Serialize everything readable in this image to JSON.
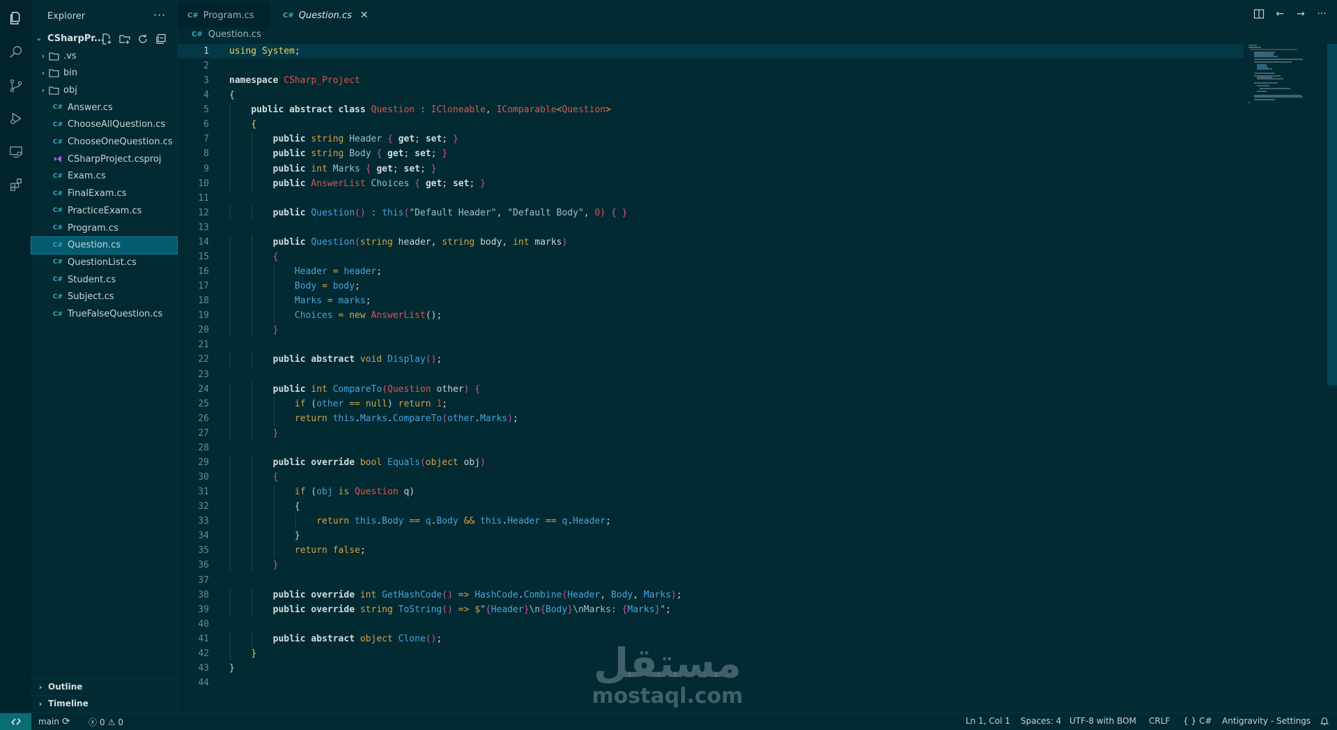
{
  "sidebar": {
    "title": "Explorer",
    "more": "···",
    "project": "CSharpPr...",
    "items": [
      {
        "label": ".vs",
        "kind": "folder"
      },
      {
        "label": "bin",
        "kind": "folder"
      },
      {
        "label": "obj",
        "kind": "folder"
      },
      {
        "label": "Answer.cs",
        "kind": "cs"
      },
      {
        "label": "ChooseAllQuestion.cs",
        "kind": "cs"
      },
      {
        "label": "ChooseOneQuestion.cs",
        "kind": "cs"
      },
      {
        "label": "CSharpProject.csproj",
        "kind": "csproj"
      },
      {
        "label": "Exam.cs",
        "kind": "cs"
      },
      {
        "label": "FinalExam.cs",
        "kind": "cs"
      },
      {
        "label": "PracticeExam.cs",
        "kind": "cs"
      },
      {
        "label": "Program.cs",
        "kind": "cs"
      },
      {
        "label": "Question.cs",
        "kind": "cs",
        "selected": true
      },
      {
        "label": "QuestionList.cs",
        "kind": "cs"
      },
      {
        "label": "Student.cs",
        "kind": "cs"
      },
      {
        "label": "Subject.cs",
        "kind": "cs"
      },
      {
        "label": "TrueFalseQuestion.cs",
        "kind": "cs"
      }
    ],
    "outline": "Outline",
    "timeline": "Timeline"
  },
  "tabs": [
    {
      "label": "Program.cs",
      "active": false
    },
    {
      "label": "Question.cs",
      "active": true
    }
  ],
  "breadcrumb": "Question.cs",
  "code": [
    [
      [
        "ns",
        "using"
      ],
      [
        "pl",
        " "
      ],
      [
        "ns",
        "System"
      ],
      [
        "pl",
        ";"
      ]
    ],
    [],
    [
      [
        "kw",
        "namespace"
      ],
      [
        "pl",
        " "
      ],
      [
        "ty",
        "CSharp_Project"
      ]
    ],
    [
      [
        "pl",
        "{"
      ]
    ],
    [
      [
        "pl",
        "    "
      ],
      [
        "kw",
        "public abstract class"
      ],
      [
        "pl",
        " "
      ],
      [
        "ty",
        "Question"
      ],
      [
        "pl",
        " "
      ],
      [
        "pt",
        ":"
      ],
      [
        "pl",
        " "
      ],
      [
        "ty",
        "ICloneable"
      ],
      [
        "pl",
        ", "
      ],
      [
        "ty",
        "IComparable"
      ],
      [
        "pt",
        "<"
      ],
      [
        "ty",
        "Question"
      ],
      [
        "pt",
        ">"
      ]
    ],
    [
      [
        "pl",
        "    "
      ],
      [
        "br1",
        "{"
      ]
    ],
    [
      [
        "pl",
        "        "
      ],
      [
        "kw",
        "public"
      ],
      [
        "pl",
        " "
      ],
      [
        "pt",
        "string"
      ],
      [
        "pl",
        " "
      ],
      [
        "st",
        "Header"
      ],
      [
        "pl",
        " "
      ],
      [
        "br2",
        "{"
      ],
      [
        "pl",
        " "
      ],
      [
        "kw",
        "get"
      ],
      [
        "pl",
        "; "
      ],
      [
        "kw",
        "set"
      ],
      [
        "pl",
        "; "
      ],
      [
        "br2",
        "}"
      ]
    ],
    [
      [
        "pl",
        "        "
      ],
      [
        "kw",
        "public"
      ],
      [
        "pl",
        " "
      ],
      [
        "pt",
        "string"
      ],
      [
        "pl",
        " "
      ],
      [
        "st",
        "Body"
      ],
      [
        "pl",
        " "
      ],
      [
        "br2",
        "{"
      ],
      [
        "pl",
        " "
      ],
      [
        "kw",
        "get"
      ],
      [
        "pl",
        "; "
      ],
      [
        "kw",
        "set"
      ],
      [
        "pl",
        "; "
      ],
      [
        "br2",
        "}"
      ]
    ],
    [
      [
        "pl",
        "        "
      ],
      [
        "kw",
        "public"
      ],
      [
        "pl",
        " "
      ],
      [
        "pt",
        "int"
      ],
      [
        "pl",
        " "
      ],
      [
        "st",
        "Marks"
      ],
      [
        "pl",
        " "
      ],
      [
        "br2",
        "{"
      ],
      [
        "pl",
        " "
      ],
      [
        "kw",
        "get"
      ],
      [
        "pl",
        "; "
      ],
      [
        "kw",
        "set"
      ],
      [
        "pl",
        "; "
      ],
      [
        "br2",
        "}"
      ]
    ],
    [
      [
        "pl",
        "        "
      ],
      [
        "kw",
        "public"
      ],
      [
        "pl",
        " "
      ],
      [
        "ty",
        "AnswerList"
      ],
      [
        "pl",
        " "
      ],
      [
        "st",
        "Choices"
      ],
      [
        "pl",
        " "
      ],
      [
        "br2",
        "{"
      ],
      [
        "pl",
        " "
      ],
      [
        "kw",
        "get"
      ],
      [
        "pl",
        "; "
      ],
      [
        "kw",
        "set"
      ],
      [
        "pl",
        "; "
      ],
      [
        "br2",
        "}"
      ]
    ],
    [],
    [
      [
        "pl",
        "        "
      ],
      [
        "kw",
        "public"
      ],
      [
        "pl",
        " "
      ],
      [
        "fn",
        "Question"
      ],
      [
        "br2",
        "()"
      ],
      [
        "pl",
        " "
      ],
      [
        "pt",
        ":"
      ],
      [
        "pl",
        " "
      ],
      [
        "fn",
        "this"
      ],
      [
        "br2",
        "("
      ],
      [
        "st",
        "\"Default Header\""
      ],
      [
        "pl",
        ", "
      ],
      [
        "st",
        "\"Default Body\""
      ],
      [
        "pl",
        ", "
      ],
      [
        "nm",
        "0"
      ],
      [
        "br2",
        ")"
      ],
      [
        "pl",
        " "
      ],
      [
        "br2",
        "{ }"
      ]
    ],
    [],
    [
      [
        "pl",
        "        "
      ],
      [
        "kw",
        "public"
      ],
      [
        "pl",
        " "
      ],
      [
        "fn",
        "Question"
      ],
      [
        "br2",
        "("
      ],
      [
        "pt",
        "string"
      ],
      [
        "pl",
        " header, "
      ],
      [
        "pt",
        "string"
      ],
      [
        "pl",
        " body, "
      ],
      [
        "pt",
        "int"
      ],
      [
        "pl",
        " marks"
      ],
      [
        "br2",
        ")"
      ]
    ],
    [
      [
        "pl",
        "        "
      ],
      [
        "br2",
        "{"
      ]
    ],
    [
      [
        "pl",
        "            "
      ],
      [
        "pr",
        "Header"
      ],
      [
        "pl",
        " "
      ],
      [
        "pt",
        "="
      ],
      [
        "pl",
        " "
      ],
      [
        "pr",
        "header"
      ],
      [
        "pl",
        ";"
      ]
    ],
    [
      [
        "pl",
        "            "
      ],
      [
        "pr",
        "Body"
      ],
      [
        "pl",
        " "
      ],
      [
        "pt",
        "="
      ],
      [
        "pl",
        " "
      ],
      [
        "pr",
        "body"
      ],
      [
        "pl",
        ";"
      ]
    ],
    [
      [
        "pl",
        "            "
      ],
      [
        "pr",
        "Marks"
      ],
      [
        "pl",
        " "
      ],
      [
        "pt",
        "="
      ],
      [
        "pl",
        " "
      ],
      [
        "pr",
        "marks"
      ],
      [
        "pl",
        ";"
      ]
    ],
    [
      [
        "pl",
        "            "
      ],
      [
        "pr",
        "Choices"
      ],
      [
        "pl",
        " "
      ],
      [
        "pt",
        "="
      ],
      [
        "pl",
        " "
      ],
      [
        "pt",
        "new"
      ],
      [
        "pl",
        " "
      ],
      [
        "ty",
        "AnswerList"
      ],
      [
        "pl",
        "();"
      ]
    ],
    [
      [
        "pl",
        "        "
      ],
      [
        "br2",
        "}"
      ]
    ],
    [],
    [
      [
        "pl",
        "        "
      ],
      [
        "kw",
        "public abstract"
      ],
      [
        "pl",
        " "
      ],
      [
        "pt",
        "void"
      ],
      [
        "pl",
        " "
      ],
      [
        "fn",
        "Display"
      ],
      [
        "br2",
        "()"
      ],
      [
        "pl",
        ";"
      ]
    ],
    [],
    [
      [
        "pl",
        "        "
      ],
      [
        "kw",
        "public"
      ],
      [
        "pl",
        " "
      ],
      [
        "pt",
        "int"
      ],
      [
        "pl",
        " "
      ],
      [
        "fn",
        "CompareTo"
      ],
      [
        "br2",
        "("
      ],
      [
        "ty",
        "Question"
      ],
      [
        "pl",
        " other"
      ],
      [
        "br2",
        ")"
      ],
      [
        "pl",
        " "
      ],
      [
        "br2",
        "{"
      ]
    ],
    [
      [
        "pl",
        "            "
      ],
      [
        "pt",
        "if"
      ],
      [
        "pl",
        " ("
      ],
      [
        "pr",
        "other"
      ],
      [
        "pl",
        " "
      ],
      [
        "pt",
        "=="
      ],
      [
        "pl",
        " "
      ],
      [
        "pt",
        "null"
      ],
      [
        "pl",
        ") "
      ],
      [
        "pt",
        "return"
      ],
      [
        "pl",
        " "
      ],
      [
        "nm",
        "1"
      ],
      [
        "pl",
        ";"
      ]
    ],
    [
      [
        "pl",
        "            "
      ],
      [
        "pt",
        "return"
      ],
      [
        "pl",
        " "
      ],
      [
        "fn",
        "this"
      ],
      [
        "pl",
        "."
      ],
      [
        "pr",
        "Marks"
      ],
      [
        "pl",
        "."
      ],
      [
        "fn",
        "CompareTo"
      ],
      [
        "br2",
        "("
      ],
      [
        "pr",
        "other"
      ],
      [
        "pl",
        "."
      ],
      [
        "pr",
        "Marks"
      ],
      [
        "br2",
        ")"
      ],
      [
        "pl",
        ";"
      ]
    ],
    [
      [
        "pl",
        "        "
      ],
      [
        "br2",
        "}"
      ]
    ],
    [],
    [
      [
        "pl",
        "        "
      ],
      [
        "kw",
        "public override"
      ],
      [
        "pl",
        " "
      ],
      [
        "pt",
        "bool"
      ],
      [
        "pl",
        " "
      ],
      [
        "fn",
        "Equals"
      ],
      [
        "br2",
        "("
      ],
      [
        "pt",
        "object"
      ],
      [
        "pl",
        " obj"
      ],
      [
        "br2",
        ")"
      ]
    ],
    [
      [
        "pl",
        "        "
      ],
      [
        "br2",
        "{"
      ]
    ],
    [
      [
        "pl",
        "            "
      ],
      [
        "pt",
        "if"
      ],
      [
        "pl",
        " ("
      ],
      [
        "pr",
        "obj"
      ],
      [
        "pl",
        " "
      ],
      [
        "pt",
        "is"
      ],
      [
        "pl",
        " "
      ],
      [
        "ty",
        "Question"
      ],
      [
        "pl",
        " q)"
      ]
    ],
    [
      [
        "pl",
        "            {"
      ]
    ],
    [
      [
        "pl",
        "                "
      ],
      [
        "pt",
        "return"
      ],
      [
        "pl",
        " "
      ],
      [
        "fn",
        "this"
      ],
      [
        "pl",
        "."
      ],
      [
        "pr",
        "Body"
      ],
      [
        "pl",
        " "
      ],
      [
        "pt",
        "=="
      ],
      [
        "pl",
        " "
      ],
      [
        "pr",
        "q"
      ],
      [
        "pl",
        "."
      ],
      [
        "pr",
        "Body"
      ],
      [
        "pl",
        " "
      ],
      [
        "pt",
        "&&"
      ],
      [
        "pl",
        " "
      ],
      [
        "fn",
        "this"
      ],
      [
        "pl",
        "."
      ],
      [
        "pr",
        "Header"
      ],
      [
        "pl",
        " "
      ],
      [
        "pt",
        "=="
      ],
      [
        "pl",
        " "
      ],
      [
        "pr",
        "q"
      ],
      [
        "pl",
        "."
      ],
      [
        "pr",
        "Header"
      ],
      [
        "pl",
        ";"
      ]
    ],
    [
      [
        "pl",
        "            }"
      ]
    ],
    [
      [
        "pl",
        "            "
      ],
      [
        "pt",
        "return"
      ],
      [
        "pl",
        " "
      ],
      [
        "pt",
        "false"
      ],
      [
        "pl",
        ";"
      ]
    ],
    [
      [
        "pl",
        "        "
      ],
      [
        "br2",
        "}"
      ]
    ],
    [],
    [
      [
        "pl",
        "        "
      ],
      [
        "kw",
        "public override"
      ],
      [
        "pl",
        " "
      ],
      [
        "pt",
        "int"
      ],
      [
        "pl",
        " "
      ],
      [
        "fn",
        "GetHashCode"
      ],
      [
        "br2",
        "()"
      ],
      [
        "pl",
        " "
      ],
      [
        "pt",
        "=>"
      ],
      [
        "pl",
        " "
      ],
      [
        "fn",
        "HashCode"
      ],
      [
        "pl",
        "."
      ],
      [
        "fn",
        "Combine"
      ],
      [
        "br2",
        "("
      ],
      [
        "pr",
        "Header"
      ],
      [
        "pl",
        ", "
      ],
      [
        "pr",
        "Body"
      ],
      [
        "pl",
        ", "
      ],
      [
        "pr",
        "Marks"
      ],
      [
        "br2",
        ")"
      ],
      [
        "pl",
        ";"
      ]
    ],
    [
      [
        "pl",
        "        "
      ],
      [
        "kw",
        "public override"
      ],
      [
        "pl",
        " "
      ],
      [
        "pt",
        "string"
      ],
      [
        "pl",
        " "
      ],
      [
        "fn",
        "ToString"
      ],
      [
        "br2",
        "()"
      ],
      [
        "pl",
        " "
      ],
      [
        "pt",
        "=>"
      ],
      [
        "pl",
        " "
      ],
      [
        "pt",
        "$"
      ],
      [
        "st",
        "\""
      ],
      [
        "br2",
        "{"
      ],
      [
        "pr",
        "Header"
      ],
      [
        "br2",
        "}"
      ],
      [
        "st",
        "\\n"
      ],
      [
        "br2",
        "{"
      ],
      [
        "pr",
        "Body"
      ],
      [
        "br2",
        "}"
      ],
      [
        "st",
        "\\nMarks: "
      ],
      [
        "br2",
        "{"
      ],
      [
        "pr",
        "Marks"
      ],
      [
        "br2",
        "}"
      ],
      [
        "st",
        "\""
      ],
      [
        "pl",
        ";"
      ]
    ],
    [],
    [
      [
        "pl",
        "        "
      ],
      [
        "kw",
        "public abstract"
      ],
      [
        "pl",
        " "
      ],
      [
        "pt",
        "object"
      ],
      [
        "pl",
        " "
      ],
      [
        "fn",
        "Clone"
      ],
      [
        "br2",
        "()"
      ],
      [
        "pl",
        ";"
      ]
    ],
    [
      [
        "pl",
        "    "
      ],
      [
        "br1",
        "}"
      ]
    ],
    [
      [
        "pl",
        "}"
      ]
    ],
    []
  ],
  "status": {
    "branch": "main",
    "errors": "0",
    "warnings": "0",
    "position": "Ln 1, Col 1",
    "spaces": "Spaces: 4",
    "encoding": "UTF-8 with BOM",
    "eol": "CRLF",
    "language": "C#",
    "language_icon": "{ }",
    "settings": "Antigravity - Settings"
  },
  "watermark": {
    "arabic": "مستقل",
    "latin": "mostaql.com"
  },
  "colors": {
    "background": "#022a33",
    "activity_bar": "#01232c",
    "selection": "#045a6f",
    "remote_badge": "#0a6d74"
  }
}
